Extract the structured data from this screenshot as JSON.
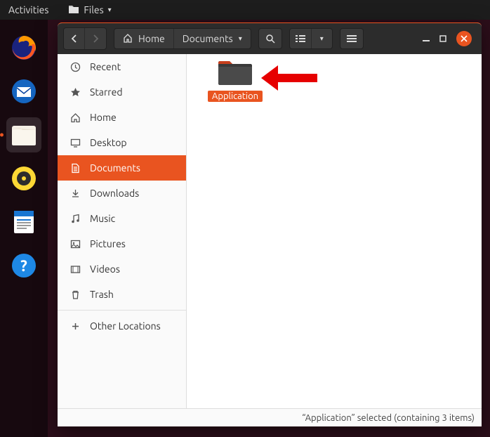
{
  "top_panel": {
    "activities": "Activities",
    "files": "Files"
  },
  "toolbar": {
    "path": [
      {
        "label": "Home",
        "has_icon": true
      },
      {
        "label": "Documents",
        "has_icon": false
      }
    ]
  },
  "sidebar": {
    "items": [
      {
        "label": "Recent",
        "icon": "clock"
      },
      {
        "label": "Starred",
        "icon": "star"
      },
      {
        "label": "Home",
        "icon": "home"
      },
      {
        "label": "Desktop",
        "icon": "desktop"
      },
      {
        "label": "Documents",
        "icon": "document",
        "active": true
      },
      {
        "label": "Downloads",
        "icon": "download"
      },
      {
        "label": "Music",
        "icon": "music"
      },
      {
        "label": "Pictures",
        "icon": "pictures"
      },
      {
        "label": "Videos",
        "icon": "videos"
      },
      {
        "label": "Trash",
        "icon": "trash"
      }
    ],
    "other": {
      "label": "Other Locations",
      "icon": "plus"
    }
  },
  "content": {
    "folder": {
      "name": "Application"
    }
  },
  "status": "“Application” selected  (containing 3 items)"
}
